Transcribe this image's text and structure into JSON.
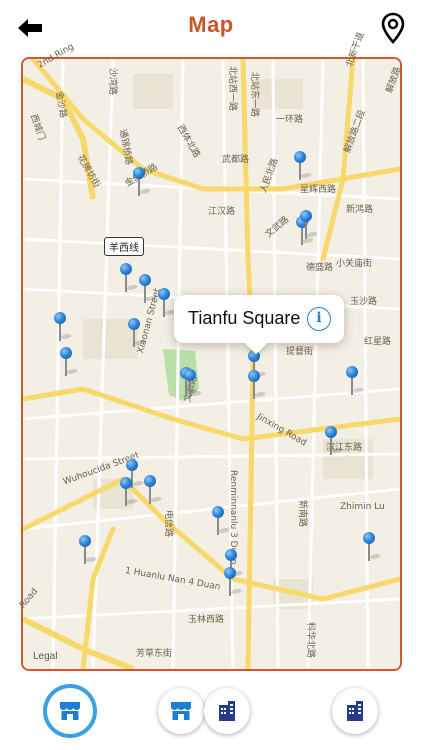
{
  "header": {
    "title": "Map",
    "back_icon": "arrow-left-icon",
    "location_icon": "map-pin-outline-icon"
  },
  "map": {
    "legal": "Legal",
    "callout": {
      "title": "Tianfu Square",
      "info_icon": "info-icon"
    },
    "line_label": "羊西线",
    "street_labels": [
      "2nd Ring",
      "金沙路",
      "沙湾路",
      "一环路",
      "北站西一路",
      "北站东一路",
      "北新干道",
      "解放路",
      "西城门",
      "通锦桥路",
      "西体北路",
      "武都路",
      "花牌坊街",
      "金仙桥路",
      "江汉路",
      "人民北路",
      "解放路二段",
      "星辉西路",
      "新鸿路",
      "文武路",
      "德盛路",
      "小关庙街",
      "玉沙路",
      "红星路",
      "提督街",
      "Xiaonan Street",
      "文翁路",
      "Jinxing Road",
      "滨江东路",
      "Zhimin Lu",
      "Wuhoucida Street",
      "Renminnanlu 3 Duan",
      "新南路",
      "电信路",
      "1 Huanlu Nan 4 Duan",
      "玉林西路",
      "芳草东街",
      "科华北路",
      "Road"
    ],
    "colors": {
      "accent": "#c8552b",
      "pin": "#2f86d8",
      "park": "#b8e0a8",
      "road_major": "#f7d96b"
    }
  },
  "bottom_bar": {
    "tabs": [
      {
        "icon": "storefront-icon",
        "active": true
      },
      {
        "icon": "storefront-icon",
        "active": false
      },
      {
        "icon": "building-icon",
        "active": false
      },
      {
        "icon": "building-icon",
        "active": false
      }
    ]
  }
}
